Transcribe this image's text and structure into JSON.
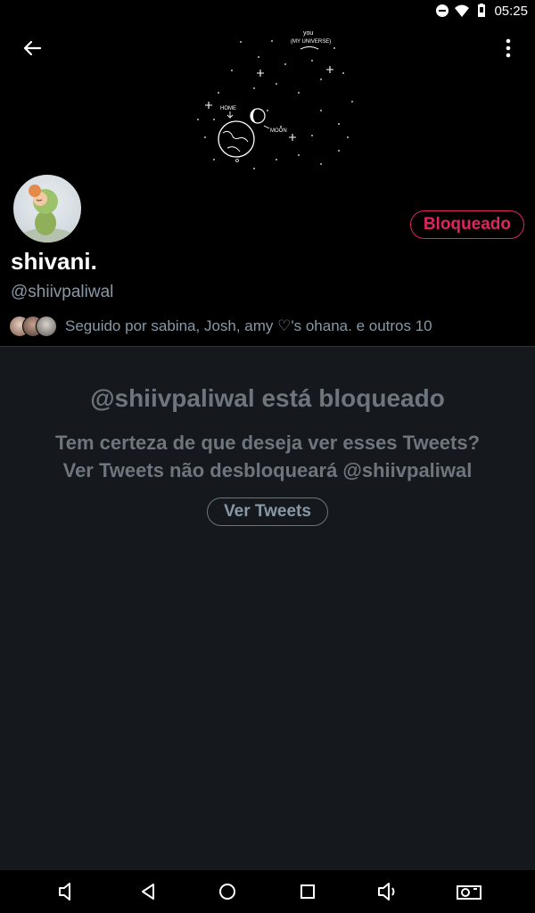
{
  "status_bar": {
    "time": "05:25",
    "icons": [
      "do-not-disturb-icon",
      "wifi-icon",
      "battery-icon"
    ]
  },
  "header": {
    "banner_text": {
      "you": "you",
      "universe": "(MY UNIVERSE)",
      "home": "HOME",
      "moon": "MOON"
    }
  },
  "profile": {
    "display_name": "shivani.",
    "handle": "@shiivpaliwal",
    "blocked_label": "Bloqueado",
    "followed_by": "Seguido por sabina, Josh, amy ♡'s ohana. e outros 10"
  },
  "blocked": {
    "title": "@shiivpaliwal está bloqueado",
    "subtitle_line1": "Tem certeza de que deseja ver esses Tweets?",
    "subtitle_line2": "Ver Tweets não desbloqueará @shiivpaliwal",
    "view_button": "Ver Tweets"
  },
  "colors": {
    "accent_blocked": "#e0245e",
    "muted": "#6e767d",
    "background": "#15181c"
  }
}
